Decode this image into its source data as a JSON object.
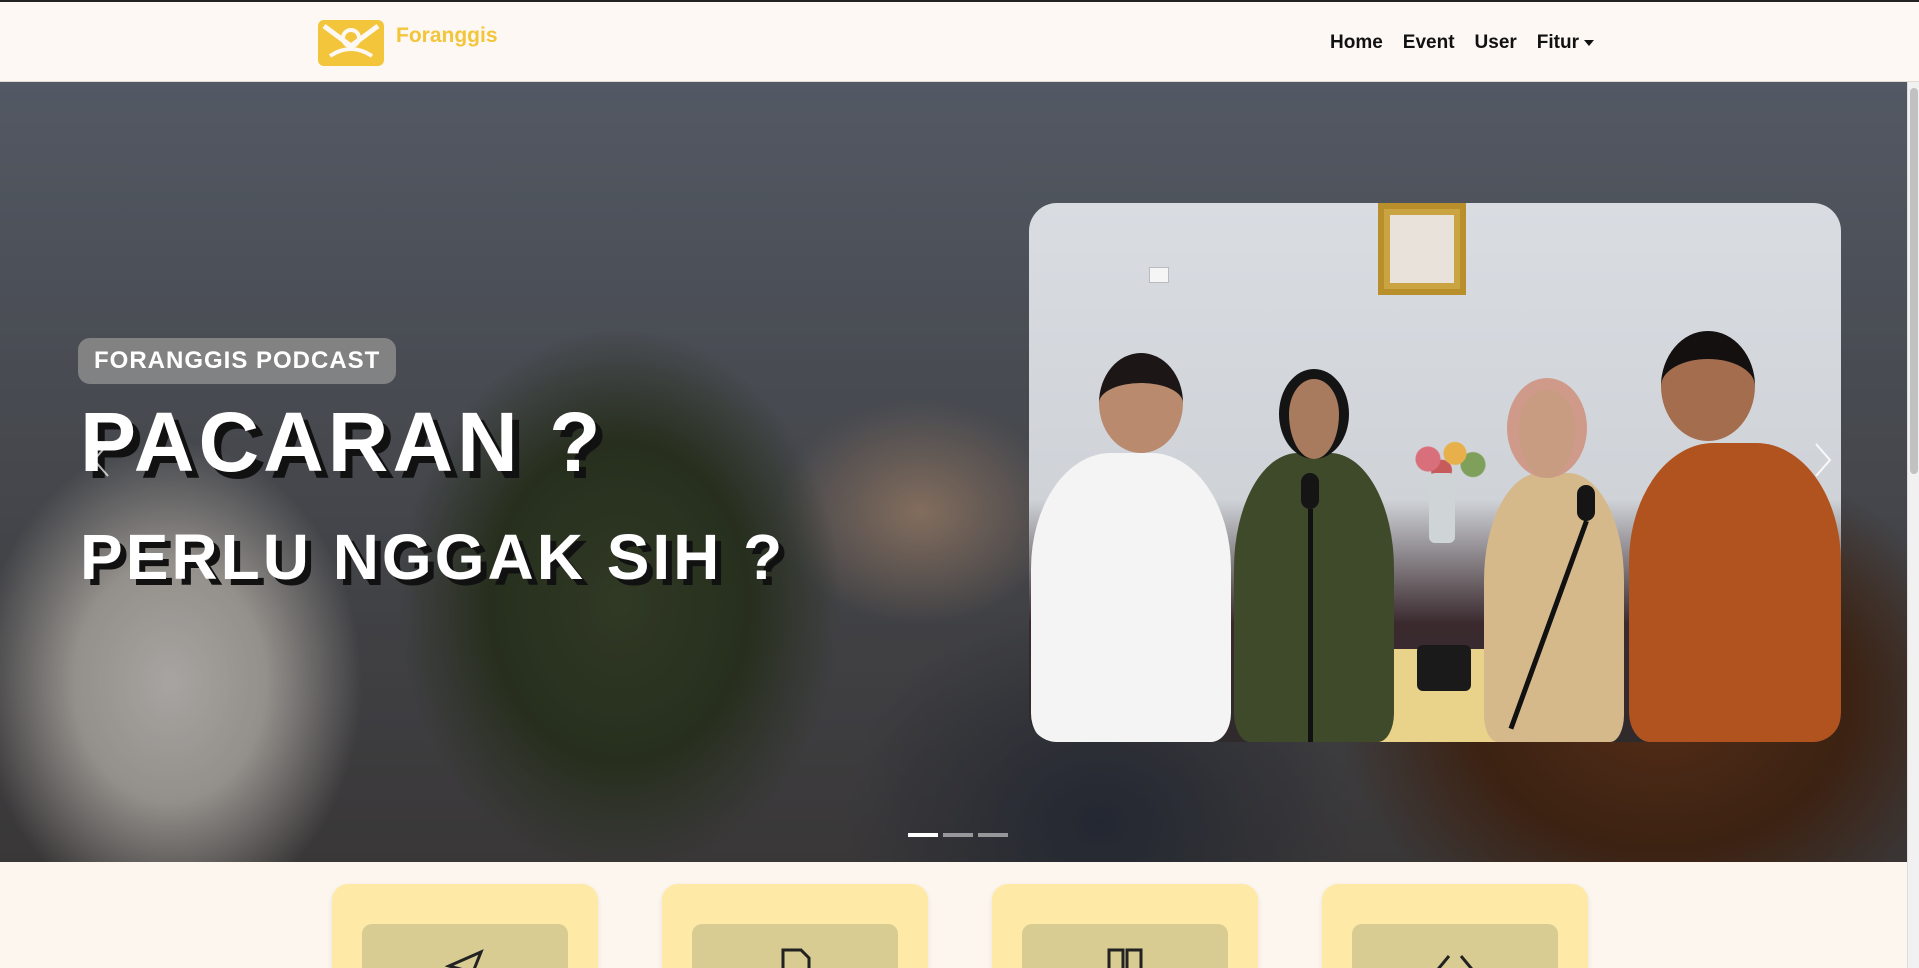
{
  "brand": {
    "name": "Foranggis"
  },
  "nav": {
    "links": [
      "Home",
      "Event",
      "User"
    ],
    "dropdown_label": "Fitur"
  },
  "hero": {
    "badge": "FORANGGIS PODCAST",
    "headline_line1": "PACARAN ?",
    "headline_line2": "PERLU NGGAK SIH ?"
  },
  "carousel": {
    "slide_count": 3,
    "active_slide": 1
  },
  "features": {
    "icons": [
      "send-icon",
      "document-icon",
      "columns-icon",
      "code-icon"
    ]
  },
  "colors": {
    "brand_yellow": "#f3c53a",
    "page_bg": "#fdf6ee",
    "card_bg": "#feeaa6",
    "icon_box": "#d8cc92"
  }
}
